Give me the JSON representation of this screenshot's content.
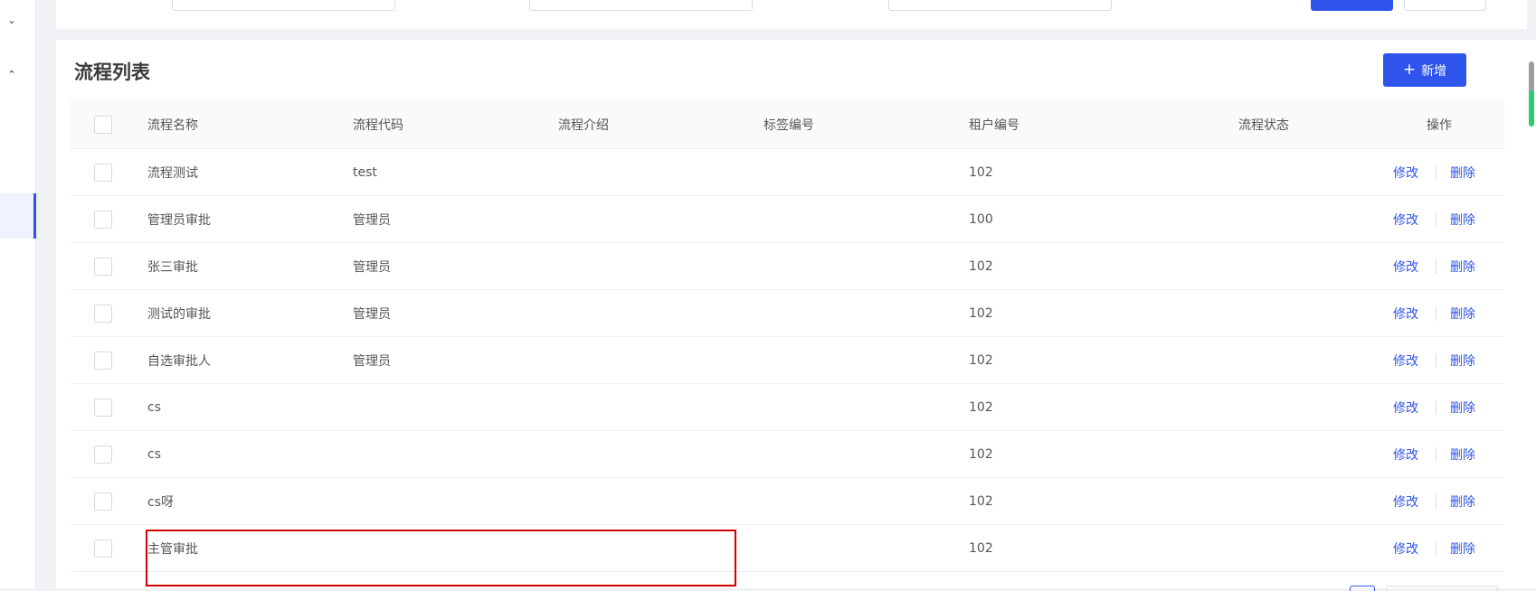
{
  "card": {
    "title": "流程列表",
    "add_button": {
      "icon": "plus-icon",
      "label": "新增"
    }
  },
  "table": {
    "columns": [
      "流程名称",
      "流程代码",
      "流程介绍",
      "标签编号",
      "租户编号",
      "流程状态",
      "操作"
    ],
    "rows": [
      {
        "name": "流程测试",
        "code": "test",
        "intro": "",
        "tag": "",
        "tenant": "102",
        "status": ""
      },
      {
        "name": "管理员审批",
        "code": "管理员",
        "intro": "",
        "tag": "",
        "tenant": "100",
        "status": ""
      },
      {
        "name": "张三审批",
        "code": "管理员",
        "intro": "",
        "tag": "",
        "tenant": "102",
        "status": ""
      },
      {
        "name": "测试的审批",
        "code": "管理员",
        "intro": "",
        "tag": "",
        "tenant": "102",
        "status": ""
      },
      {
        "name": "自选审批人",
        "code": "管理员",
        "intro": "",
        "tag": "",
        "tenant": "102",
        "status": ""
      },
      {
        "name": "cs",
        "code": "",
        "intro": "",
        "tag": "",
        "tenant": "102",
        "status": ""
      },
      {
        "name": "cs",
        "code": "",
        "intro": "",
        "tag": "",
        "tenant": "102",
        "status": ""
      },
      {
        "name": "cs呀",
        "code": "",
        "intro": "",
        "tag": "",
        "tenant": "102",
        "status": ""
      },
      {
        "name": "主管审批",
        "code": "",
        "intro": "",
        "tag": "",
        "tenant": "102",
        "status": ""
      }
    ],
    "ops": {
      "edit_label": "修改",
      "delete_label": "删除"
    }
  },
  "colors": {
    "primary": "#2f54eb",
    "highlight": "#d40000",
    "scroll_accent": "#2ecc71"
  }
}
